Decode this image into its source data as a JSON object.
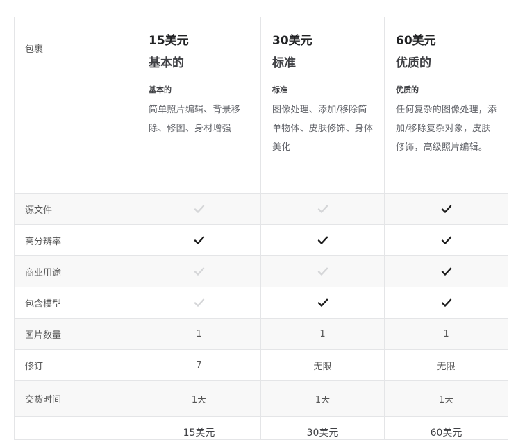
{
  "table": {
    "header_label": "包裹",
    "packages": [
      {
        "price": "15美元",
        "name": "基本的",
        "title": "基本的",
        "description": "简单照片编辑、背景移除、修图、身材增强"
      },
      {
        "price": "30美元",
        "name": "标准",
        "title": "标准",
        "description": "图像处理、添加/移除简单物体、皮肤修饰、身体美化"
      },
      {
        "price": "60美元",
        "name": "优质的",
        "title": "优质的",
        "description": "任何复杂的图像处理，添加/移除复杂对象，皮肤修饰，高级照片编辑。"
      }
    ],
    "features": [
      {
        "name": "源文件",
        "values": [
          false,
          false,
          true
        ]
      },
      {
        "name": "高分辨率",
        "values": [
          true,
          true,
          true
        ]
      },
      {
        "name": "商业用途",
        "values": [
          false,
          false,
          true
        ]
      },
      {
        "name": "包含模型",
        "values": [
          false,
          true,
          true
        ]
      },
      {
        "name": "图片数量",
        "values": [
          "1",
          "1",
          "1"
        ]
      },
      {
        "name": "修订",
        "values": [
          "7",
          "无限",
          "无限"
        ]
      },
      {
        "name": "交货时间",
        "values": [
          "1天",
          "1天",
          "1天"
        ]
      }
    ],
    "footer_prices": [
      "15美元",
      "30美元",
      "60美元"
    ]
  },
  "icons": {
    "check_included": "check-icon",
    "check_excluded": "check-icon-disabled"
  },
  "colors": {
    "check_on": "#1b1b1b",
    "check_off": "#d5d6d8",
    "stripe": "#f8f8f8",
    "border": "#e4e5e7"
  }
}
